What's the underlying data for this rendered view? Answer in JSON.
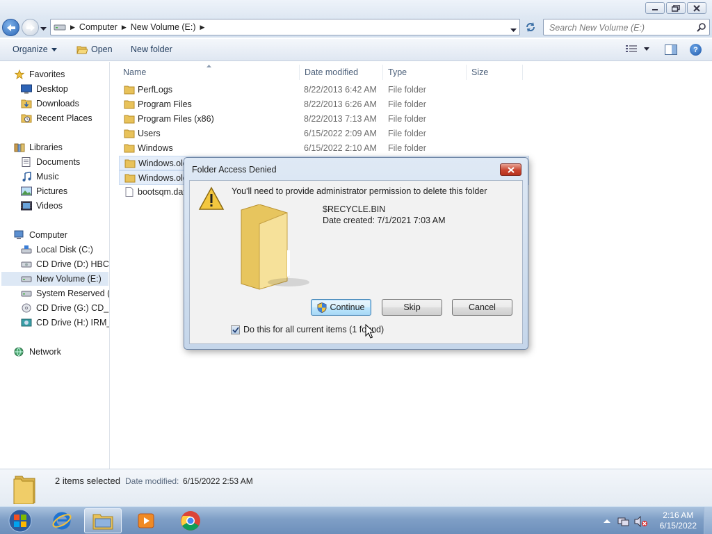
{
  "window": {
    "caption_buttons": [
      "minimize",
      "restore",
      "close"
    ]
  },
  "address": {
    "crumbs": [
      "Computer",
      "New Volume (E:)"
    ],
    "search_placeholder": "Search New Volume (E:)"
  },
  "toolbar": {
    "organize": "Organize",
    "open": "Open",
    "new_folder": "New folder"
  },
  "nav": {
    "favorites": "Favorites",
    "desktop": "Desktop",
    "downloads": "Downloads",
    "recent_places": "Recent Places",
    "libraries": "Libraries",
    "documents": "Documents",
    "music": "Music",
    "pictures": "Pictures",
    "videos": "Videos",
    "computer": "Computer",
    "local_disk": "Local Disk (C:)",
    "cd_d": "CD Drive (D:) HBCD_",
    "new_volume": "New Volume (E:)",
    "system_reserved": "System Reserved (F:)",
    "cd_g": "CD Drive (G:) CD_RO",
    "cd_h": "CD Drive (H:) IRM_SI",
    "network": "Network"
  },
  "columns": {
    "name": "Name",
    "date_modified": "Date modified",
    "type": "Type",
    "size": "Size"
  },
  "files": [
    {
      "name": "PerfLogs",
      "date": "8/22/2013 6:42 AM",
      "type": "File folder"
    },
    {
      "name": "Program Files",
      "date": "8/22/2013 6:26 AM",
      "type": "File folder"
    },
    {
      "name": "Program Files (x86)",
      "date": "8/22/2013 7:13 AM",
      "type": "File folder"
    },
    {
      "name": "Users",
      "date": "6/15/2022 2:09 AM",
      "type": "File folder"
    },
    {
      "name": "Windows",
      "date": "6/15/2022 2:10 AM",
      "type": "File folder"
    },
    {
      "name": "Windows.old",
      "date": "",
      "type": ""
    },
    {
      "name": "Windows.old",
      "date": "",
      "type": ""
    },
    {
      "name": "bootsqm.dat",
      "date": "",
      "type": ""
    }
  ],
  "details": {
    "count": "2 items selected",
    "modified_label": "Date modified:",
    "modified_value": "6/15/2022 2:53 AM"
  },
  "dialog": {
    "title": "Folder Access Denied",
    "message": "You'll need to provide administrator permission to delete this folder",
    "item_name": "$RECYCLE.BIN",
    "date_created": "Date created: 7/1/2021 7:03 AM",
    "continue": "Continue",
    "skip": "Skip",
    "cancel": "Cancel",
    "checkbox_label": "Do this for all current items (1 found)",
    "checkbox_checked": true
  },
  "clock": {
    "time": "2:16 AM",
    "date": "6/15/2022"
  }
}
